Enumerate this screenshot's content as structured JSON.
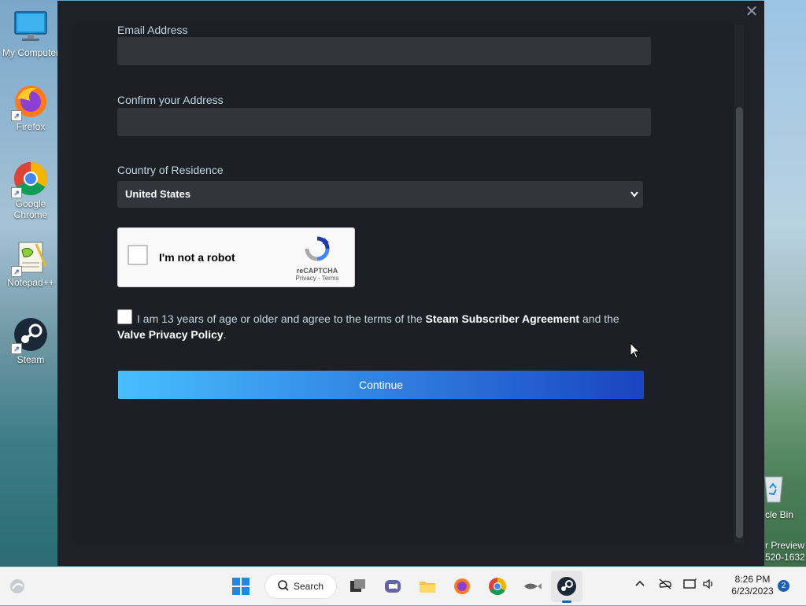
{
  "desktop": {
    "icons": [
      {
        "label": "My Computer"
      },
      {
        "label": "Firefox"
      },
      {
        "label": "Google Chrome"
      },
      {
        "label": "Notepad++"
      },
      {
        "label": "Steam"
      }
    ],
    "right_edge": {
      "recycle_label": "cle Bin",
      "preview_line1": "r Preview",
      "preview_line2": "520-1632"
    }
  },
  "form": {
    "email_label": "Email Address",
    "email_value": "",
    "confirm_label": "Confirm your Address",
    "confirm_value": "",
    "country_label": "Country of Residence",
    "country_value": "United States",
    "captcha": {
      "text": "I'm not a robot",
      "brand": "reCAPTCHA",
      "links": "Privacy - Terms"
    },
    "agreement": {
      "prefix": "I am 13 years of age or older and agree to the terms of the",
      "link1": "Steam Subscriber Agreement",
      "middle": "and the",
      "link2": "Valve Privacy Policy",
      "suffix": "."
    },
    "continue_label": "Continue"
  },
  "taskbar": {
    "search_label": "Search",
    "time": "8:26 PM",
    "date": "6/23/2023",
    "notification_count": "2"
  },
  "colors": {
    "dialog_bg": "#1e2128",
    "field_bg": "#32353c",
    "label_text": "#c6d4df",
    "button_start": "#47bfff",
    "button_end": "#1a44c2"
  }
}
